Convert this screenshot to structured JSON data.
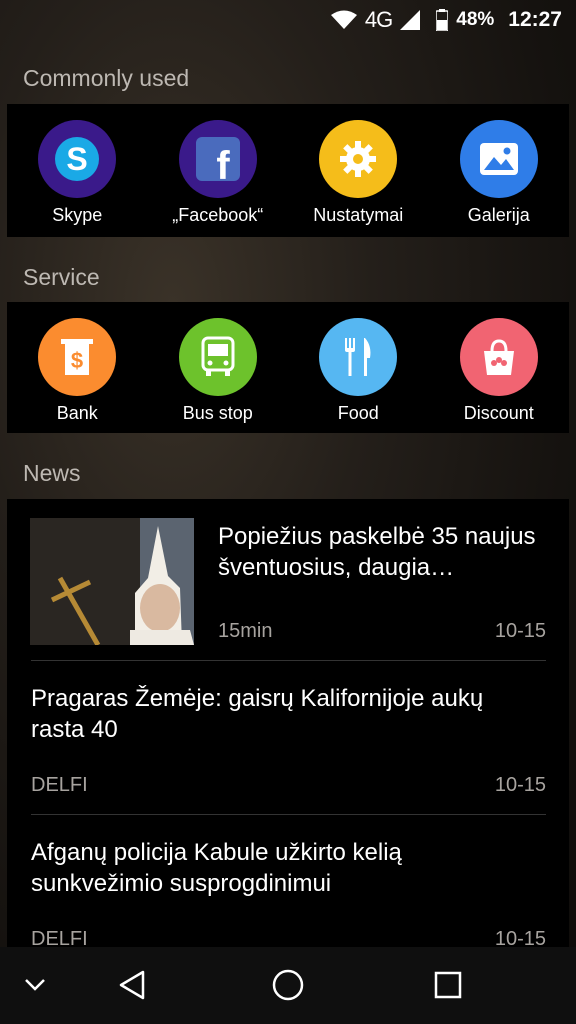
{
  "status_bar": {
    "network": "4G",
    "battery": "48%",
    "time": "12:27",
    "icons": [
      "wifi-icon",
      "signal-icon",
      "battery-icon"
    ]
  },
  "sections": {
    "common_title": "Commonly used",
    "service_title": "Service",
    "news_title": "News"
  },
  "common_apps": [
    {
      "label": "Skype",
      "color": "#3a1a8a",
      "icon": "skype-icon"
    },
    {
      "label": "„Facebook“",
      "color": "#3a1a8a",
      "icon": "facebook-icon"
    },
    {
      "label": "Nustatymai",
      "color": "#f5bd1a",
      "icon": "gear-icon"
    },
    {
      "label": "Galerija",
      "color": "#2f7de8",
      "icon": "gallery-icon"
    }
  ],
  "service_apps": [
    {
      "label": "Bank",
      "color": "#fb8c2f",
      "icon": "bank-icon"
    },
    {
      "label": "Bus stop",
      "color": "#6dc22c",
      "icon": "bus-icon"
    },
    {
      "label": "Food",
      "color": "#56b7f2",
      "icon": "cutlery-icon"
    },
    {
      "label": "Discount",
      "color": "#f16472",
      "icon": "shopping-bag-icon"
    }
  ],
  "news": [
    {
      "title": "Popiežius paskelbė 35 naujus šventuosius, daugia…",
      "source": "15min",
      "date": "10-15"
    },
    {
      "title": "Pragaras Žemėje: gaisrų Kalifornijoje aukų rasta 40",
      "source": "DELFI",
      "date": "10-15"
    },
    {
      "title": "Afganų policija Kabule užkirto kelią sunkvežimio susprogdinimui",
      "source": "DELFI",
      "date": "10-15"
    }
  ],
  "nav": [
    "collapse-chevron-icon",
    "back-icon",
    "home-icon",
    "recents-icon"
  ]
}
